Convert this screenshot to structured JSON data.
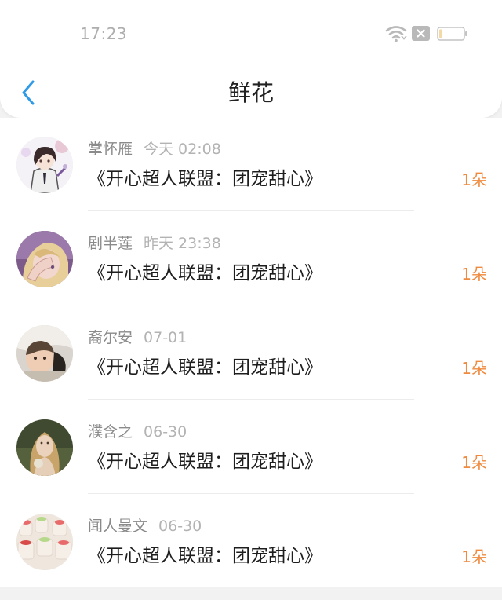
{
  "status_bar": {
    "time": "17:23",
    "icons": [
      "wifi-icon",
      "sim-icon",
      "battery-icon"
    ]
  },
  "nav": {
    "back_icon": "chevron-left-icon",
    "title": "鲜花"
  },
  "colors": {
    "accent": "#2f9be8",
    "amount": "#ef8a3e",
    "title": "#222222",
    "secondary_text": "#8a8a8a"
  },
  "items": [
    {
      "name": "掌怀雁",
      "date": "今天 02:08",
      "book": "《开心超人联盟：团宠甜心》",
      "amount": "1朵",
      "avatar": "anime-boy-avatar"
    },
    {
      "name": "剧半莲",
      "date": "昨天 23:38",
      "book": "《开心超人联盟：团宠甜心》",
      "amount": "1朵",
      "avatar": "anime-girl-avatar"
    },
    {
      "name": "裔尔安",
      "date": "07-01",
      "book": "《开心超人联盟：团宠甜心》",
      "amount": "1朵",
      "avatar": "baby-photo-avatar"
    },
    {
      "name": "濮含之",
      "date": "06-30",
      "book": "《开心超人联盟：团宠甜心》",
      "amount": "1朵",
      "avatar": "woman-photo-avatar"
    },
    {
      "name": "闻人曼文",
      "date": "06-30",
      "book": "《开心超人联盟：团宠甜心》",
      "amount": "1朵",
      "avatar": "candles-photo-avatar"
    }
  ]
}
